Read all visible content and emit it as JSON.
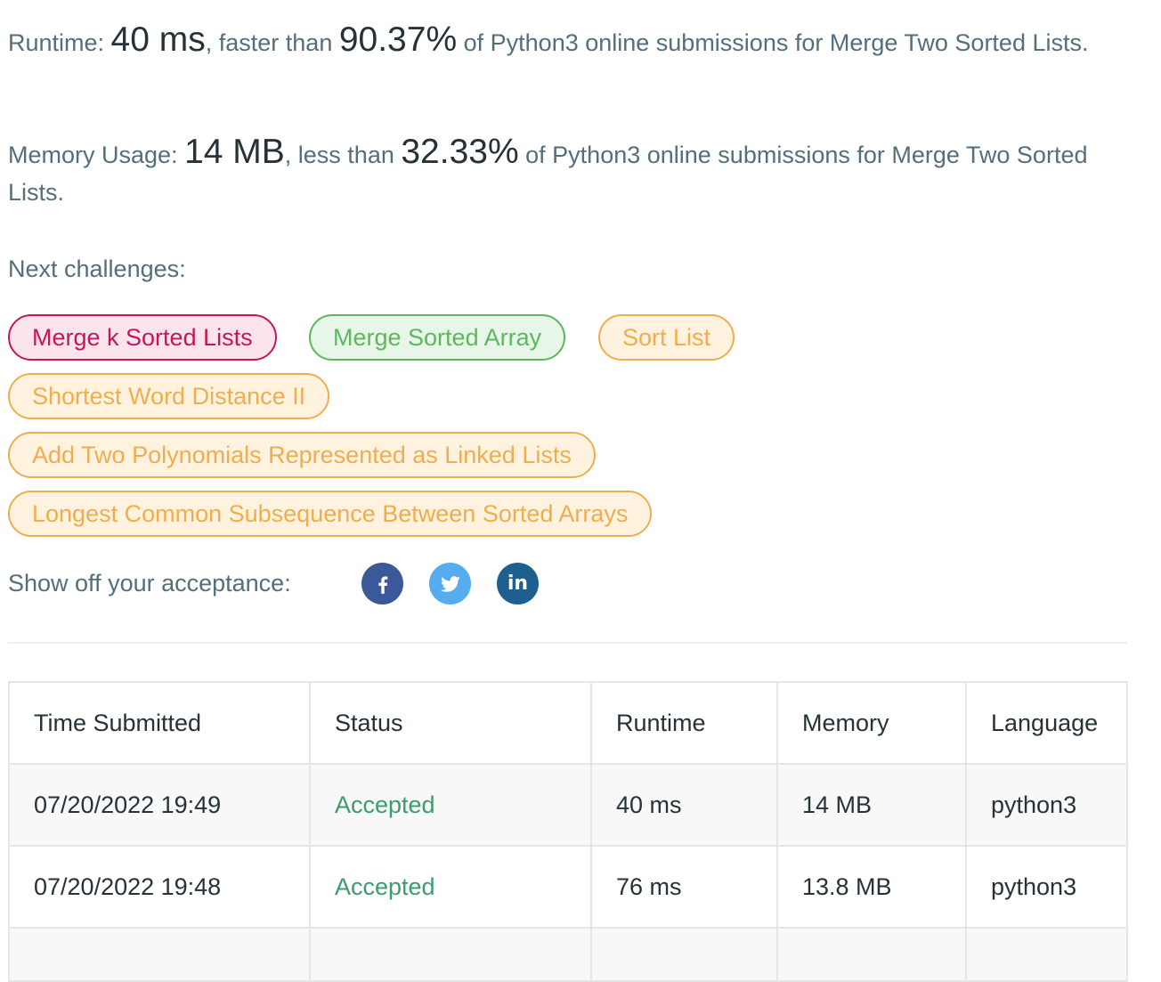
{
  "runtime": {
    "label": "Runtime: ",
    "value": "40 ms",
    "faster_text": ", faster than ",
    "percent": "90.37%",
    "suffix": " of Python3 online submissions for Merge Two Sorted Lists."
  },
  "memory": {
    "label": "Memory Usage: ",
    "value": "14 MB",
    "less_text": ", less than ",
    "percent": "32.33%",
    "suffix": " of Python3 online submissions for Merge Two Sorted Lists."
  },
  "next_challenges": {
    "label": "Next challenges:",
    "items": [
      {
        "label": "Merge k Sorted Lists",
        "difficulty": "hard"
      },
      {
        "label": "Merge Sorted Array",
        "difficulty": "easy"
      },
      {
        "label": "Sort List",
        "difficulty": "medium"
      },
      {
        "label": "Shortest Word Distance II",
        "difficulty": "medium"
      },
      {
        "label": "Add Two Polynomials Represented as Linked Lists",
        "difficulty": "medium"
      },
      {
        "label": "Longest Common Subsequence Between Sorted Arrays",
        "difficulty": "medium"
      }
    ]
  },
  "share": {
    "label": "Show off your acceptance:",
    "icons": [
      {
        "name": "facebook-icon",
        "color": "#3b5998"
      },
      {
        "name": "twitter-icon",
        "color": "#55acee"
      },
      {
        "name": "linkedin-icon",
        "color": "#1f5f90"
      }
    ],
    "linkedin_glyph": "in"
  },
  "colors": {
    "hard": "#c2185b",
    "easy": "#5cb85c",
    "medium": "#f0ad4e",
    "accepted": "#3c9c6d"
  },
  "submissions": {
    "headers": [
      "Time Submitted",
      "Status",
      "Runtime",
      "Memory",
      "Language"
    ],
    "rows": [
      {
        "time": "07/20/2022 19:49",
        "status": "Accepted",
        "runtime": "40 ms",
        "memory": "14 MB",
        "language": "python3"
      },
      {
        "time": "07/20/2022 19:48",
        "status": "Accepted",
        "runtime": "76 ms",
        "memory": "13.8 MB",
        "language": "python3"
      }
    ]
  }
}
